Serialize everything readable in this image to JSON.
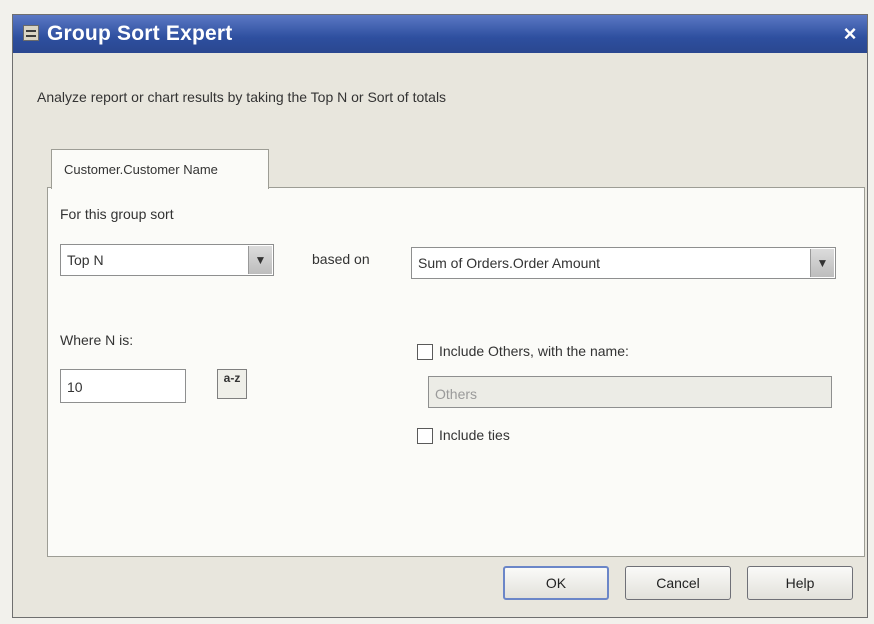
{
  "window": {
    "title": "Group Sort Expert",
    "close_glyph": "×",
    "description": "Analyze report or chart results by taking the Top N or Sort of totals"
  },
  "tab": {
    "label": "Customer.Customer Name"
  },
  "form": {
    "group_sort_label": "For this group sort",
    "group_sort_value": "Top N",
    "based_on_label": "based on",
    "based_on_value": "Sum of Orders.Order Amount",
    "where_n_label": "Where N is:",
    "n_value": "10",
    "sort_icon_glyph": "a-z",
    "include_others_label": "Include Others, with the name:",
    "include_others_checked": false,
    "others_name_value": "Others",
    "include_ties_label": "Include ties",
    "include_ties_checked": false
  },
  "buttons": {
    "ok": "OK",
    "cancel": "Cancel",
    "help": "Help"
  },
  "icons": {
    "title": "report-expert-icon",
    "dropdown": "chevron-down-icon",
    "sort": "sort-az-icon",
    "close": "close-icon"
  },
  "colors": {
    "titlebar": "#2e4f9f",
    "default_button_border": "#6b86c8"
  }
}
